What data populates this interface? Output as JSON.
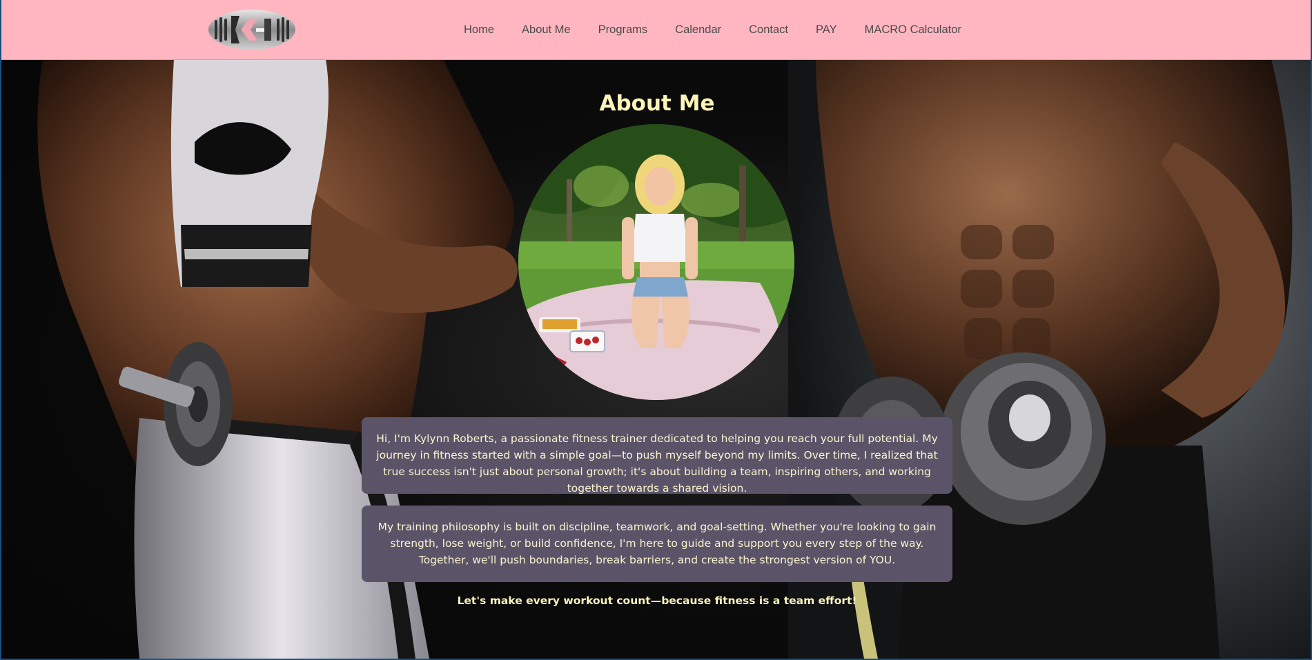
{
  "header": {
    "logo_alt": "KR logo",
    "nav": [
      {
        "label": "Home"
      },
      {
        "label": "About Me"
      },
      {
        "label": "Programs"
      },
      {
        "label": "Calendar"
      },
      {
        "label": "Contact"
      },
      {
        "label": "PAY"
      },
      {
        "label": "MACRO Calculator"
      }
    ]
  },
  "main": {
    "title": "About Me",
    "paragraph_1": "Hi, I'm Kylynn Roberts, a passionate fitness trainer dedicated to helping you reach your full potential. My journey in fitness started with a simple goal—to push myself beyond my limits. Over time, I realized that true success isn't just about personal growth; it's about building a team, inspiring others, and working together towards a shared vision.",
    "paragraph_2": "My training philosophy is built on discipline, teamwork, and goal-setting. Whether you're looking to gain strength, lose weight, or build confidence, I'm here to guide and support you every step of the way. Together, we'll push boundaries, break barriers, and create the strongest version of YOU.",
    "tagline": "Let's make every workout count—because fitness is a team effort!"
  },
  "colors": {
    "header_bg": "#ffb6c1",
    "title": "#fcf4b8",
    "card_bg": "#5b5468",
    "text": "#fcf4d0"
  }
}
